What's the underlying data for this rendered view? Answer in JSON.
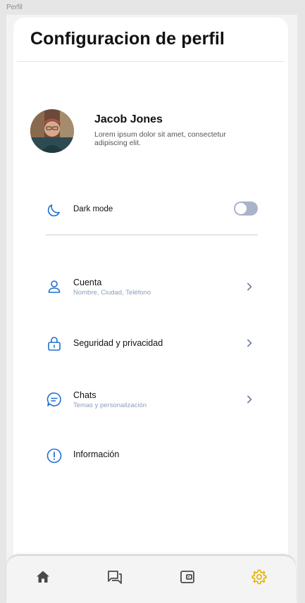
{
  "frame_label": "Perfil",
  "header": {
    "title": "Configuracion de perfil"
  },
  "profile": {
    "name": "Jacob Jones",
    "description": "Lorem ipsum dolor sit amet, consectetur adipiscing elit."
  },
  "dark_mode": {
    "label": "Dark mode",
    "enabled": false
  },
  "settings": [
    {
      "label": "Cuenta",
      "subtitle": "Nombre, Ciudad, Teléfono",
      "icon": "user-icon"
    },
    {
      "label": "Seguridad y privacidad",
      "subtitle": "",
      "icon": "lock-icon"
    },
    {
      "label": "Chats",
      "subtitle": "Temas y personalización",
      "icon": "chat-icon"
    },
    {
      "label": "Información",
      "subtitle": "",
      "icon": "info-icon"
    }
  ],
  "nav": {
    "items": [
      "home-icon",
      "messages-icon",
      "wallet-icon",
      "settings-gear-icon"
    ],
    "active": "settings-gear-icon"
  },
  "colors": {
    "accent_blue": "#1f6fd1",
    "active_nav": "#e5b100",
    "nav_icon": "#4a4a4a"
  }
}
